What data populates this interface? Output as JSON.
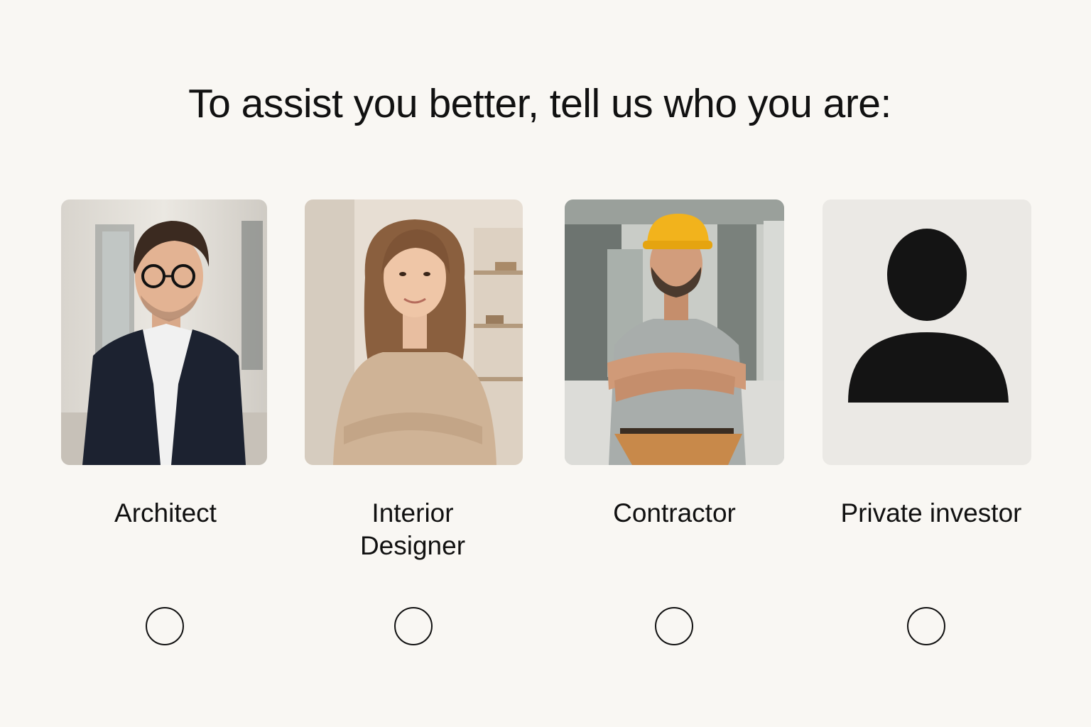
{
  "heading": "To assist you better, tell us who you are:",
  "options": [
    {
      "label": "Architect"
    },
    {
      "label": "Interior Designer"
    },
    {
      "label": "Contractor"
    },
    {
      "label": "Private investor"
    }
  ],
  "colors": {
    "background": "#f9f7f3",
    "text": "#111111",
    "hard_hat": "#f2b31c",
    "placeholder_bg": "#ebe9e5"
  }
}
